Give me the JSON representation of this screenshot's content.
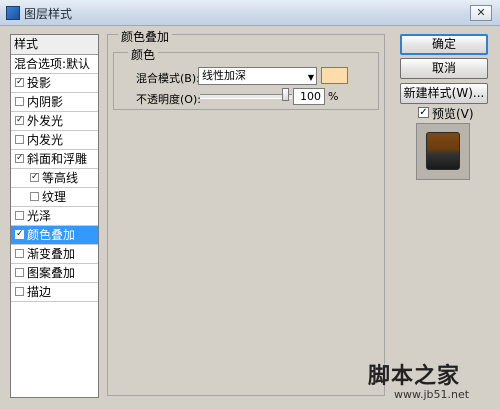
{
  "window": {
    "title": "图层样式",
    "close_symbol": "✕"
  },
  "left_panel": {
    "header": "样式",
    "items": [
      {
        "label": "混合选项:默认",
        "has_checkbox": false,
        "checked": false,
        "indent": false,
        "selected": false
      },
      {
        "label": "投影",
        "has_checkbox": true,
        "checked": true,
        "indent": false,
        "selected": false
      },
      {
        "label": "内阴影",
        "has_checkbox": true,
        "checked": false,
        "indent": false,
        "selected": false
      },
      {
        "label": "外发光",
        "has_checkbox": true,
        "checked": true,
        "indent": false,
        "selected": false
      },
      {
        "label": "内发光",
        "has_checkbox": true,
        "checked": false,
        "indent": false,
        "selected": false
      },
      {
        "label": "斜面和浮雕",
        "has_checkbox": true,
        "checked": true,
        "indent": false,
        "selected": false
      },
      {
        "label": "等高线",
        "has_checkbox": true,
        "checked": true,
        "indent": true,
        "selected": false
      },
      {
        "label": "纹理",
        "has_checkbox": true,
        "checked": false,
        "indent": true,
        "selected": false
      },
      {
        "label": "光泽",
        "has_checkbox": true,
        "checked": false,
        "indent": false,
        "selected": false
      },
      {
        "label": "颜色叠加",
        "has_checkbox": true,
        "checked": true,
        "indent": false,
        "selected": true
      },
      {
        "label": "渐变叠加",
        "has_checkbox": true,
        "checked": false,
        "indent": false,
        "selected": false
      },
      {
        "label": "图案叠加",
        "has_checkbox": true,
        "checked": false,
        "indent": false,
        "selected": false
      },
      {
        "label": "描边",
        "has_checkbox": true,
        "checked": false,
        "indent": false,
        "selected": false
      }
    ]
  },
  "content": {
    "group_title": "颜色叠加",
    "subgroup_title": "颜色",
    "blend_mode_label": "混合模式(B):",
    "blend_mode_value": "线性加深",
    "overlay_color": "#ffdcaa",
    "opacity_label": "不透明度(O):",
    "opacity_value": "100",
    "opacity_unit": "%",
    "opacity_level": 1.0
  },
  "buttons": {
    "ok": "确定",
    "cancel": "取消",
    "new_style": "新建样式(W)...",
    "preview_label": "预览(V)",
    "preview_checked": true
  },
  "watermark": {
    "logo": "脚本之家",
    "url": "www.jb51.net"
  },
  "colors": {
    "selection": "#3399ff",
    "dialog_bg": "#d4d0c8",
    "default_button_border": "#2f7ed8"
  }
}
